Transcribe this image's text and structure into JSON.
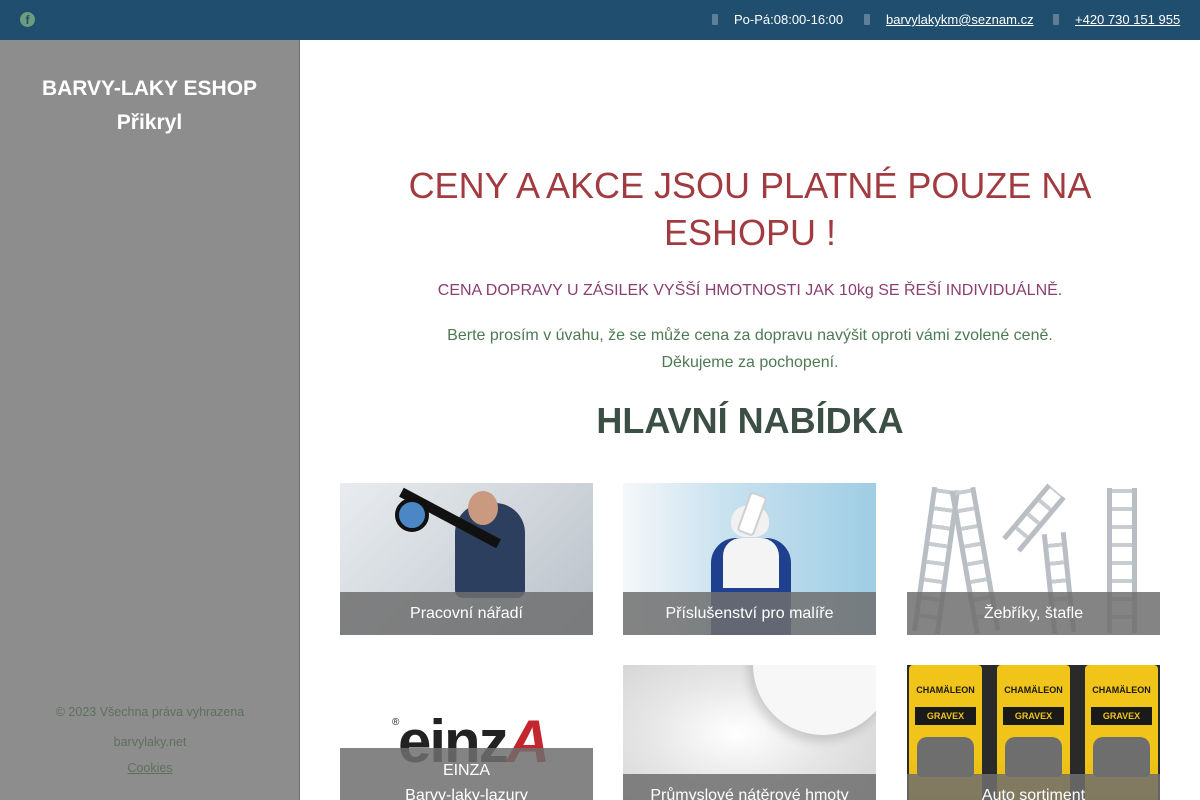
{
  "topbar": {
    "facebook_icon": "facebook-icon",
    "hours": "Po-Pá:08:00-16:00",
    "email": "barvylakykm@seznam.cz",
    "phone": "+420 730 151 955"
  },
  "sidebar": {
    "brand_line1": "BARVY-LAKY ESHOP",
    "brand_line2": "Přikryl",
    "copyright": "© 2023 Všechna práva vyhrazena",
    "domain": "barvylaky.net",
    "cookies": "Cookies"
  },
  "main": {
    "headline": "CENY A AKCE JSOU PLATNÉ POUZE NA ESHOPU !",
    "shipping_notice": "CENA DOPRAVY U ZÁSILEK VYŠŠÍ HMOTNOSTI JAK 10kg SE ŘEŠÍ INDIVIDUÁLNĚ.",
    "info_line1": "Berte prosím v úvahu, že se může cena za dopravu navýšit oproti vámi zvolené ceně.",
    "info_line2": "Děkujeme za pochopení.",
    "section_title": "HLAVNÍ NABÍDKA",
    "categories": [
      {
        "label": "Pracovní nářadí"
      },
      {
        "label": "Příslušenství pro malíře"
      },
      {
        "label": "Žebříky, štafle"
      },
      {
        "label_line1": "EINZA",
        "label_line2": "Barvy-laky-lazury",
        "logo_text": "EINZA"
      },
      {
        "label": "Průmyslové nátěrové hmoty"
      },
      {
        "label": "Auto sortiment",
        "can_brand": "CHAMÄLEON",
        "can_product": "GRAVEX"
      }
    ]
  },
  "colors": {
    "topbar_bg": "#1f4e6f",
    "sidebar_bg": "#8d8d8d",
    "headline": "#a23b40",
    "section_title": "#3c4f45"
  }
}
